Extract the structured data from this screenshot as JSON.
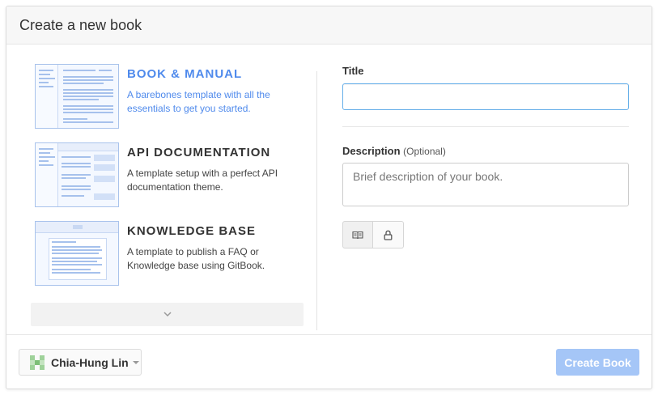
{
  "header": {
    "title": "Create a new book"
  },
  "templates": [
    {
      "title": "BOOK & MANUAL",
      "description": "A barebones template with all the essentials to get you started.",
      "selected": true
    },
    {
      "title": "API DOCUMENTATION",
      "description": "A template setup with a perfect API documentation theme.",
      "selected": false
    },
    {
      "title": "KNOWLEDGE BASE",
      "description": "A template to publish a FAQ or Knowledge base using GitBook.",
      "selected": false
    }
  ],
  "more_icon": "chevron-down-icon",
  "form": {
    "title_label": "Title",
    "title_value": "",
    "description_label": "Description",
    "description_optional": "(Optional)",
    "description_placeholder": "Brief description of your book.",
    "visibility_icons": [
      "book-icon",
      "lock-icon"
    ]
  },
  "footer": {
    "user_name": "Chia-Hung Lin",
    "create_label": "Create Book"
  },
  "colors": {
    "accent": "#4f8aec",
    "create_button": "#a5c6f7",
    "avatar": "#9fd29a"
  }
}
